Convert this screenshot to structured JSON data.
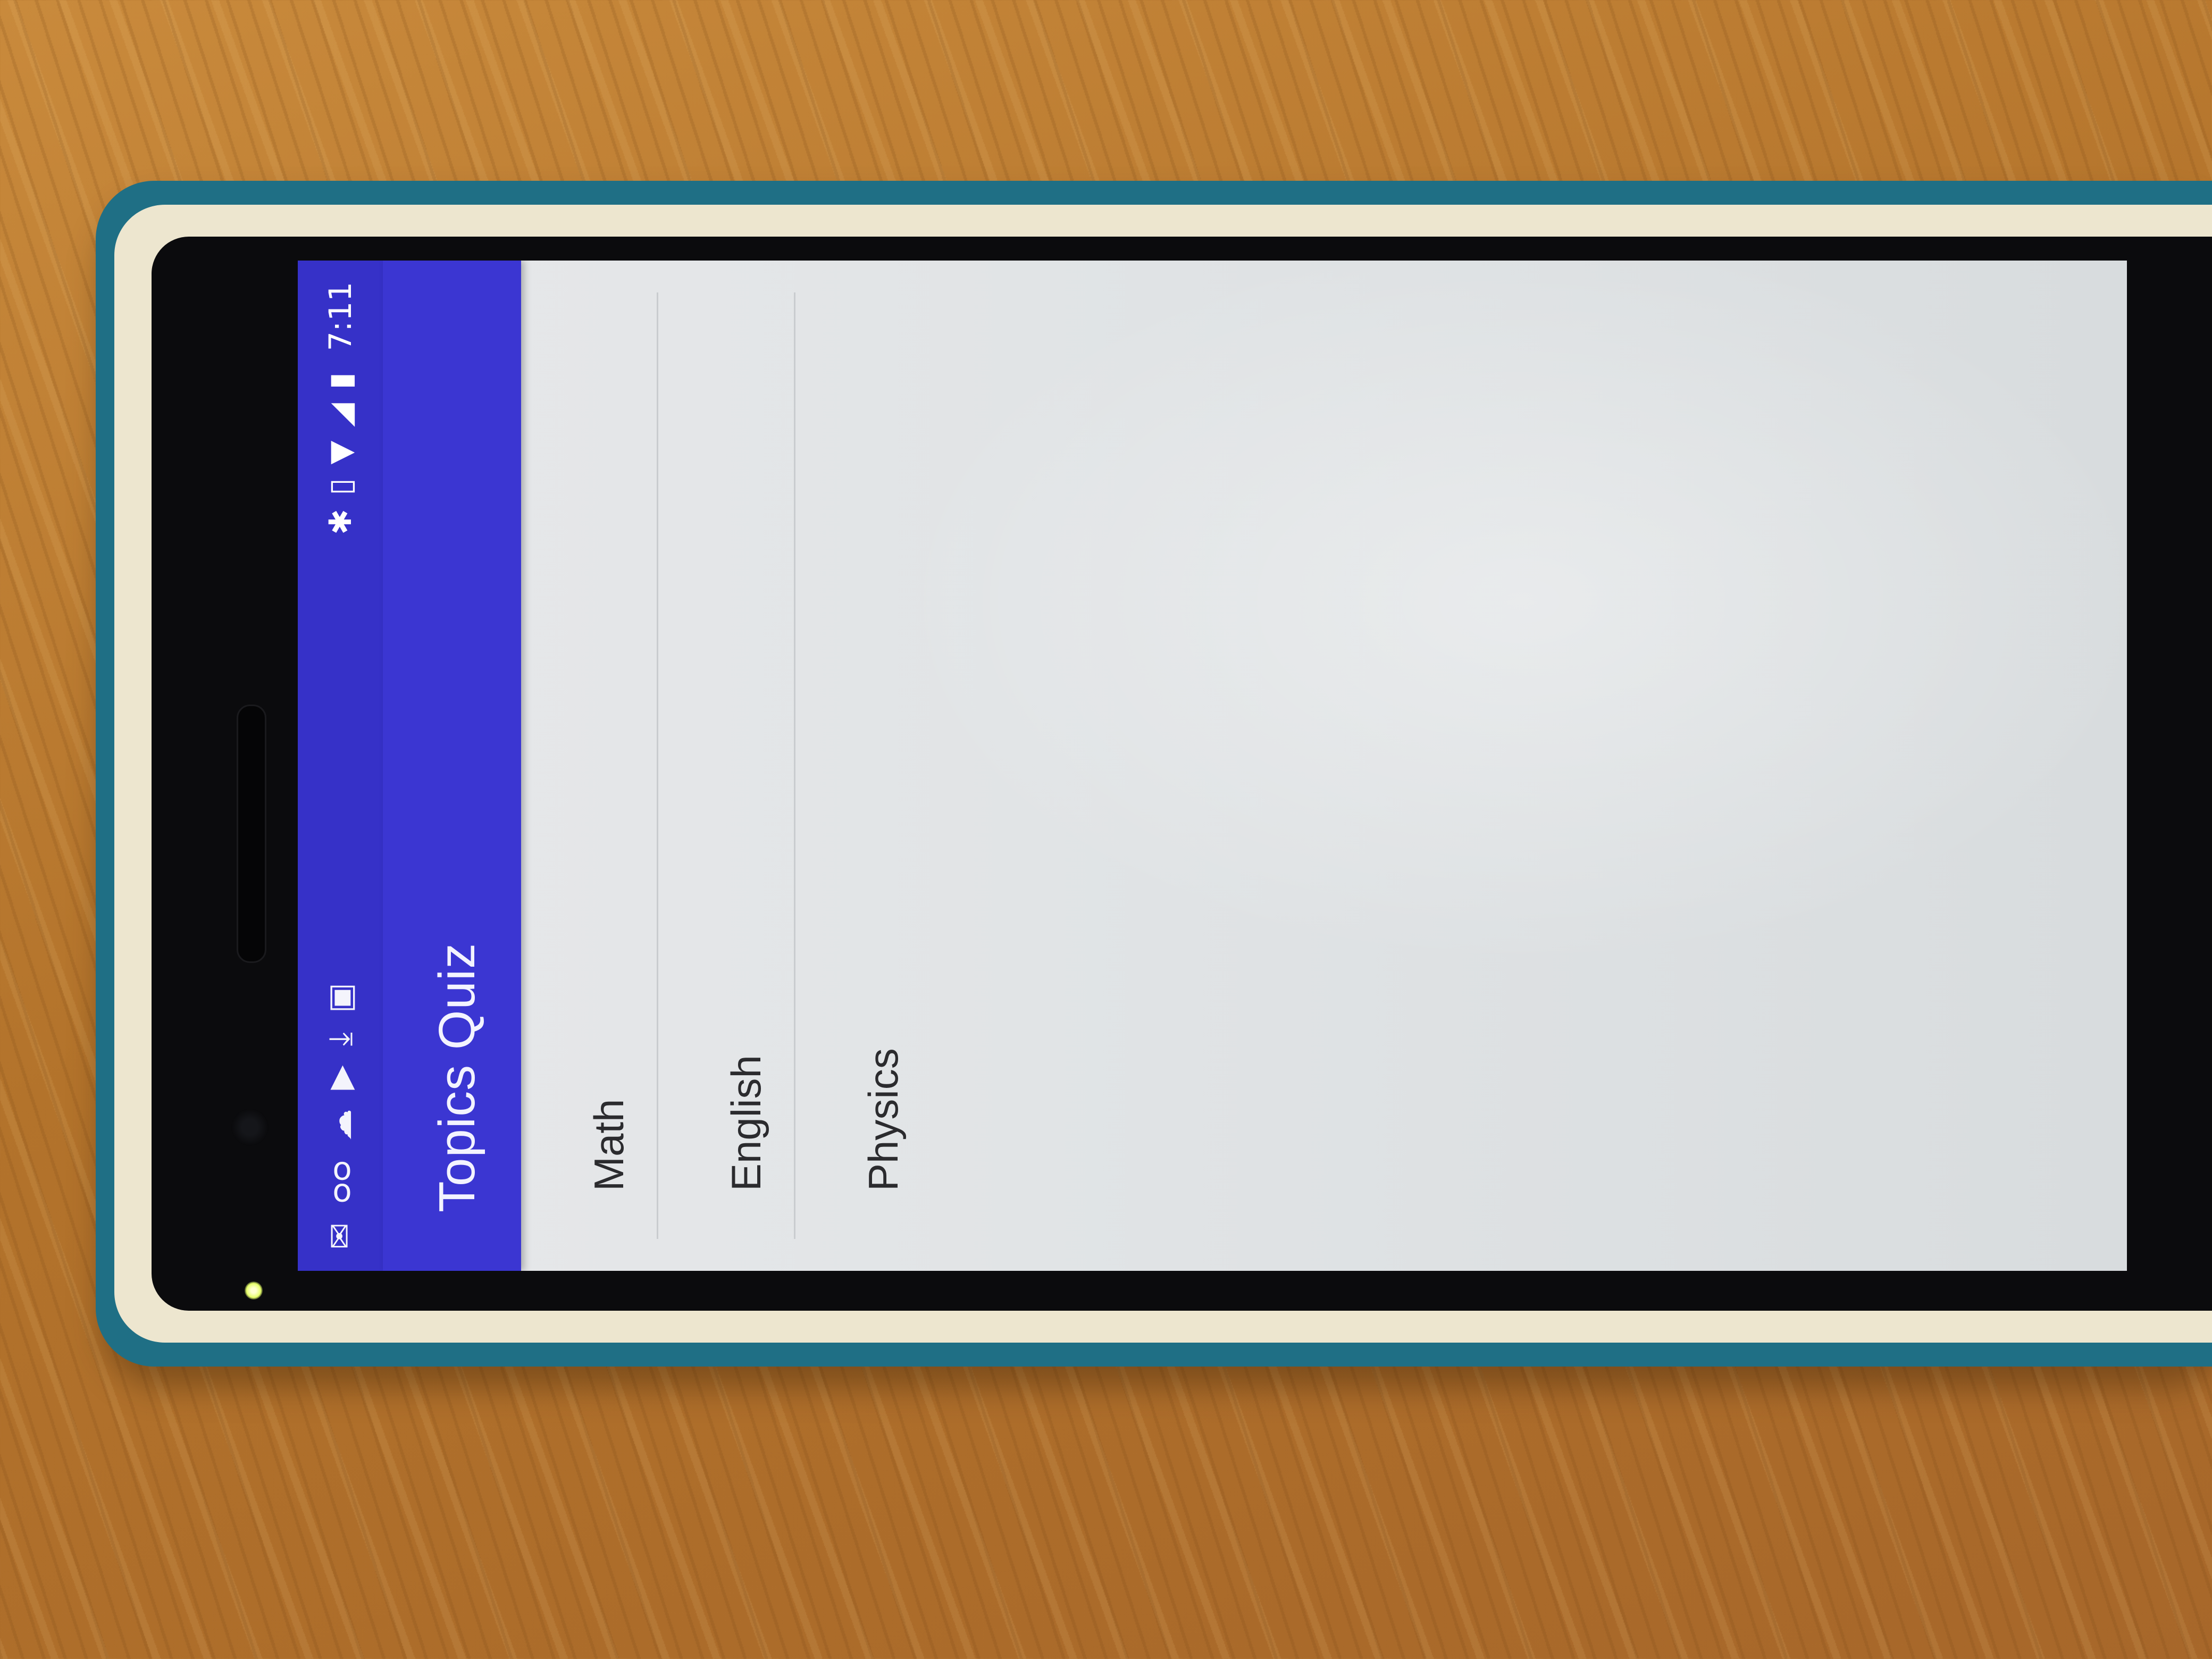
{
  "status_bar": {
    "left_icons": [
      "mail-icon",
      "voicemail-icon",
      "cloud-icon",
      "play-icon",
      "download-icon",
      "android-icon"
    ],
    "right_icons": [
      "bluetooth-icon",
      "vibrate-icon",
      "wifi-icon",
      "signal-icon",
      "battery-icon"
    ],
    "time": "7:11"
  },
  "toolbar": {
    "title": "Topics Quiz",
    "color": "#3b36d2"
  },
  "topics": [
    {
      "label": "Math"
    },
    {
      "label": "English"
    },
    {
      "label": "Physics"
    }
  ]
}
